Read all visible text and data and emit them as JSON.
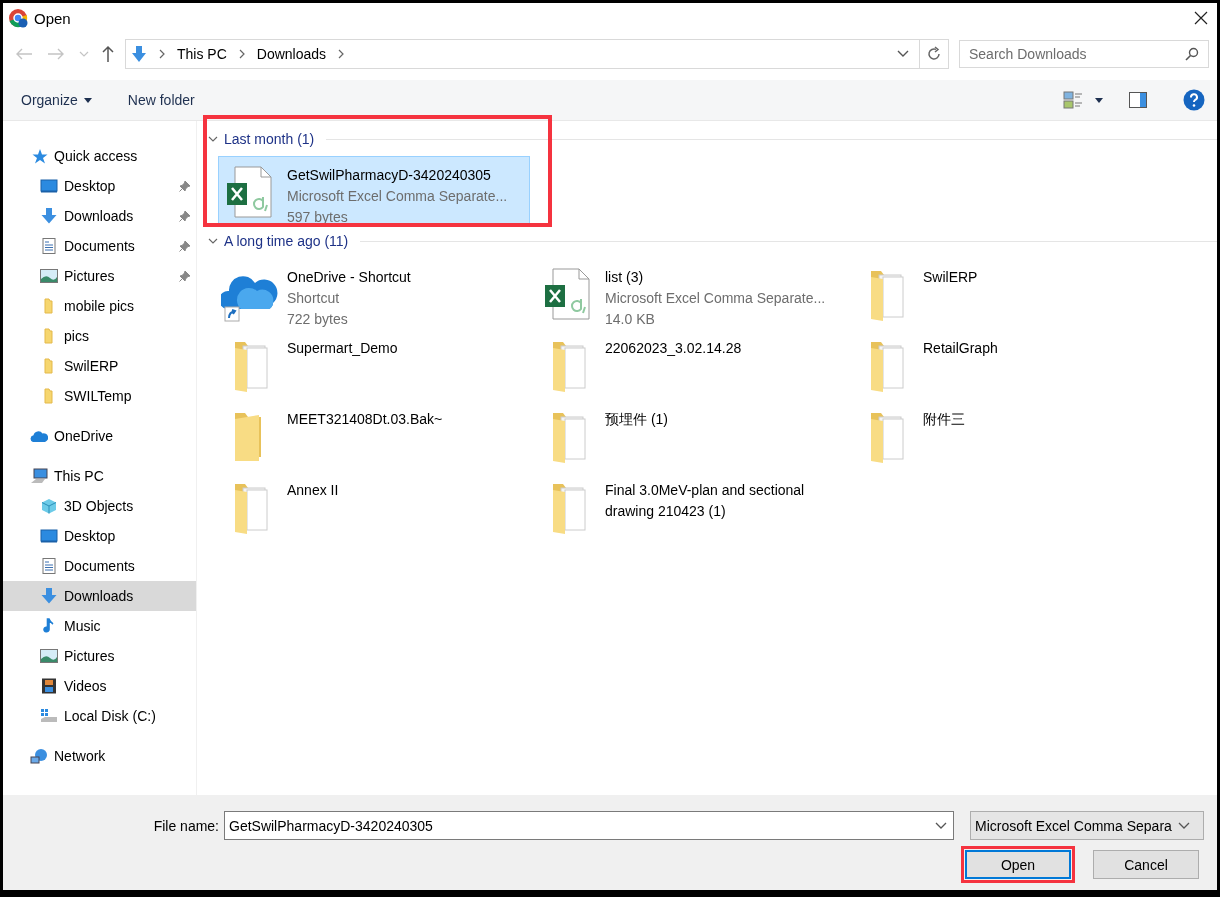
{
  "window": {
    "title": "Open"
  },
  "address": {
    "crumbs": [
      "This PC",
      "Downloads"
    ]
  },
  "search": {
    "placeholder": "Search Downloads"
  },
  "toolbar": [
    {
      "label": "Organize",
      "dropdown": true
    },
    {
      "label": "New folder",
      "dropdown": false
    }
  ],
  "sidebar": [
    {
      "label": "Quick access",
      "kind": "star",
      "selected": false,
      "children": [
        {
          "label": "Desktop",
          "kind": "desktop",
          "pinned": true,
          "selected": false
        },
        {
          "label": "Downloads",
          "kind": "download",
          "pinned": true,
          "selected": false
        },
        {
          "label": "Documents",
          "kind": "document",
          "pinned": true,
          "selected": false
        },
        {
          "label": "Pictures",
          "kind": "picture",
          "pinned": true,
          "selected": false
        },
        {
          "label": "mobile pics",
          "kind": "folder",
          "pinned": false,
          "selected": false
        },
        {
          "label": "pics",
          "kind": "folder",
          "pinned": false,
          "selected": false
        },
        {
          "label": "SwilERP",
          "kind": "folder",
          "pinned": false,
          "selected": false
        },
        {
          "label": "SWILTemp",
          "kind": "folder",
          "pinned": false,
          "selected": false
        }
      ]
    },
    {
      "label": "OneDrive",
      "kind": "cloud",
      "selected": false
    },
    {
      "label": "This PC",
      "kind": "pc",
      "selected": false,
      "children": [
        {
          "label": "3D Objects",
          "kind": "cube",
          "pinned": false,
          "selected": false
        },
        {
          "label": "Desktop",
          "kind": "desktop",
          "pinned": false,
          "selected": false
        },
        {
          "label": "Documents",
          "kind": "document",
          "pinned": false,
          "selected": false
        },
        {
          "label": "Downloads",
          "kind": "download",
          "pinned": false,
          "selected": true
        },
        {
          "label": "Music",
          "kind": "music",
          "pinned": false,
          "selected": false
        },
        {
          "label": "Pictures",
          "kind": "picture",
          "pinned": false,
          "selected": false
        },
        {
          "label": "Videos",
          "kind": "video",
          "pinned": false,
          "selected": false
        },
        {
          "label": "Local Disk (C:)",
          "kind": "disk",
          "pinned": false,
          "selected": false
        }
      ]
    },
    {
      "label": "Network",
      "kind": "network",
      "selected": false
    }
  ],
  "groups": [
    {
      "label": "Last month (1)",
      "expanded": true,
      "highlighted": true,
      "items": [
        {
          "name": "GetSwilPharmacyD-3420240305",
          "details": [
            "Microsoft Excel Comma Separate...",
            "597 bytes"
          ],
          "kind": "excel",
          "selected": true
        }
      ]
    },
    {
      "label": "A long time ago (11)",
      "expanded": true,
      "highlighted": false,
      "items": [
        {
          "name": "OneDrive - Shortcut",
          "details": [
            "Shortcut",
            "722 bytes"
          ],
          "kind": "cloud",
          "selected": false
        },
        {
          "name": "list (3)",
          "details": [
            "Microsoft Excel Comma Separate...",
            "14.0 KB"
          ],
          "kind": "excel",
          "selected": false
        },
        {
          "name": "SwilERP",
          "kind": "folder-files",
          "selected": false
        },
        {
          "name": "Supermart_Demo",
          "kind": "folder-files",
          "selected": false
        },
        {
          "name": "22062023_3.02.14.28",
          "kind": "folder-files",
          "selected": false
        },
        {
          "name": "RetailGraph",
          "kind": "folder-files",
          "selected": false
        },
        {
          "name": "MEET321408Dt.03.Bak~",
          "kind": "folder",
          "selected": false
        },
        {
          "name": "预埋件 (1)",
          "kind": "folder-files",
          "selected": false
        },
        {
          "name": "附件三",
          "kind": "folder-files",
          "selected": false
        },
        {
          "name": "Annex II",
          "kind": "folder-files",
          "selected": false
        },
        {
          "name": "Final 3.0MeV-plan and sectional drawing 210423 (1)",
          "kind": "folder-files",
          "selected": false
        }
      ]
    }
  ],
  "file_name": {
    "label": "File name:",
    "value": "GetSwilPharmacyD-3420240305"
  },
  "file_type": {
    "value": "Microsoft Excel Comma Separa"
  },
  "buttons": [
    {
      "label": "Open",
      "highlighted": true
    },
    {
      "label": "Cancel",
      "highlighted": false
    }
  ]
}
